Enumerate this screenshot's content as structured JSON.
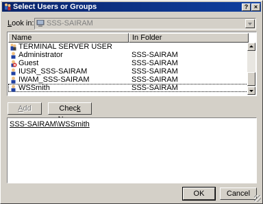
{
  "window": {
    "title": "Select Users or Groups",
    "help_label": "?",
    "close_label": "×"
  },
  "look_in": {
    "label_prefix": "",
    "label_underlined": "L",
    "label_suffix": "ook in:",
    "value": "SSS-SAIRAM"
  },
  "columns": [
    "Name",
    "In Folder"
  ],
  "rows": [
    {
      "name": "TERMINAL SERVER USER",
      "folder": "",
      "icon": "group-icon"
    },
    {
      "name": "Administrator",
      "folder": "SSS-SAIRAM",
      "icon": "user-icon"
    },
    {
      "name": "Guest",
      "folder": "SSS-SAIRAM",
      "icon": "disabled-user-icon"
    },
    {
      "name": "IUSR_SSS-SAIRAM",
      "folder": "SSS-SAIRAM",
      "icon": "user-icon"
    },
    {
      "name": "IWAM_SSS-SAIRAM",
      "folder": "SSS-SAIRAM",
      "icon": "user-icon"
    },
    {
      "name": "WSSmith",
      "folder": "SSS-SAIRAM",
      "icon": "user-icon",
      "selected": true
    }
  ],
  "buttons": {
    "add": {
      "pre": "",
      "u": "A",
      "post": "dd"
    },
    "check": {
      "pre": "Chec",
      "u": "k",
      "post": " Names"
    },
    "ok": "OK",
    "cancel": "Cancel"
  },
  "selected_names": "SSS-SAIRAM\\WSSmith",
  "colors": {
    "title_bar": "#0a246a",
    "face": "#d4d0c8"
  }
}
